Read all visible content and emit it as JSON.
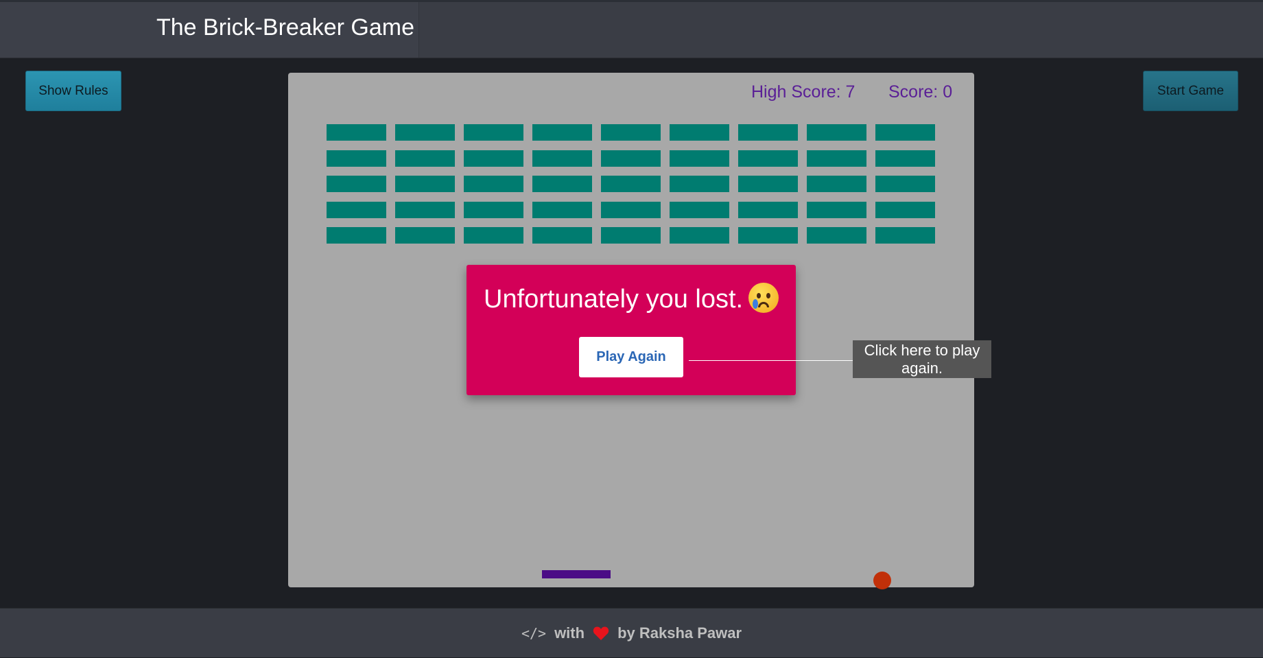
{
  "header": {
    "title": "The Brick-Breaker Game"
  },
  "controls": {
    "show_rules_label": "Show Rules",
    "start_game_label": "Start Game"
  },
  "scoreboard": {
    "high_score_text": "High Score: 7",
    "score_text": "Score: 0"
  },
  "bricks": {
    "rows": 5,
    "columns": 9,
    "color": "#007c70"
  },
  "board": {
    "background": "#a8a8a8",
    "paddle_color": "#4b0c86",
    "ball_color": "#c13009"
  },
  "modal": {
    "message": "Unfortunately you lost.",
    "emoji": "crying-face-icon",
    "play_again_label": "Play Again",
    "background": "#d30058"
  },
  "tooltip": {
    "text": "Click here to play again."
  },
  "footer": {
    "with_text": "with",
    "by_text": "by Raksha Pawar",
    "code_icon": "code-icon",
    "heart_icon": "heart-icon",
    "heart_color": "#e8141c"
  }
}
